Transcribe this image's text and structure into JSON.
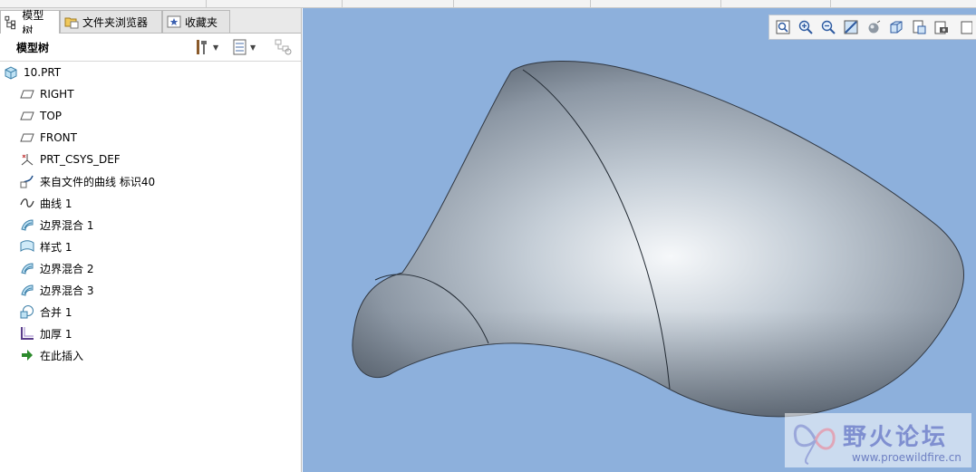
{
  "tabs": [
    {
      "label": "模型树",
      "icon": "model-tree-icon",
      "active": true
    },
    {
      "label": "文件夹浏览器",
      "icon": "folder-browser-icon",
      "active": false
    },
    {
      "label": "收藏夹",
      "icon": "favorites-icon",
      "active": false
    }
  ],
  "tree_header": {
    "title": "模型树",
    "settings_icon": "tools-icon",
    "show_icon": "list-icon",
    "filter_icon": "tree-filter-icon"
  },
  "tree": [
    {
      "label": "10.PRT",
      "icon": "part-icon"
    },
    {
      "label": "RIGHT",
      "icon": "datum-plane-icon"
    },
    {
      "label": "TOP",
      "icon": "datum-plane-icon"
    },
    {
      "label": "FRONT",
      "icon": "datum-plane-icon"
    },
    {
      "label": "PRT_CSYS_DEF",
      "icon": "coordinate-system-icon"
    },
    {
      "label": "来自文件的曲线 标识40",
      "icon": "curve-from-file-icon"
    },
    {
      "label": "曲线 1",
      "icon": "curve-icon"
    },
    {
      "label": "边界混合 1",
      "icon": "boundary-blend-icon"
    },
    {
      "label": "样式 1",
      "icon": "style-icon"
    },
    {
      "label": "边界混合 2",
      "icon": "boundary-blend-icon"
    },
    {
      "label": "边界混合 3",
      "icon": "boundary-blend-icon"
    },
    {
      "label": "合并 1",
      "icon": "merge-icon"
    },
    {
      "label": "加厚 1",
      "icon": "thicken-icon"
    },
    {
      "label": "在此插入",
      "icon": "insert-here-arrow-icon"
    }
  ],
  "view_toolbar": [
    "refit-icon",
    "zoom-in-icon",
    "zoom-out-icon",
    "repaint-icon",
    "shading-icon",
    "view-orientation-icon",
    "saved-views-icon",
    "display-style-icon",
    "more-icon"
  ],
  "watermark": {
    "title": "野火论坛",
    "url": "www.proewildfire.cn"
  },
  "colors": {
    "viewport_bg": "#8db0dc",
    "surface_light": "#f2f5f8",
    "surface_dark": "#4e5864",
    "insert_arrow": "#2c8a2c"
  }
}
